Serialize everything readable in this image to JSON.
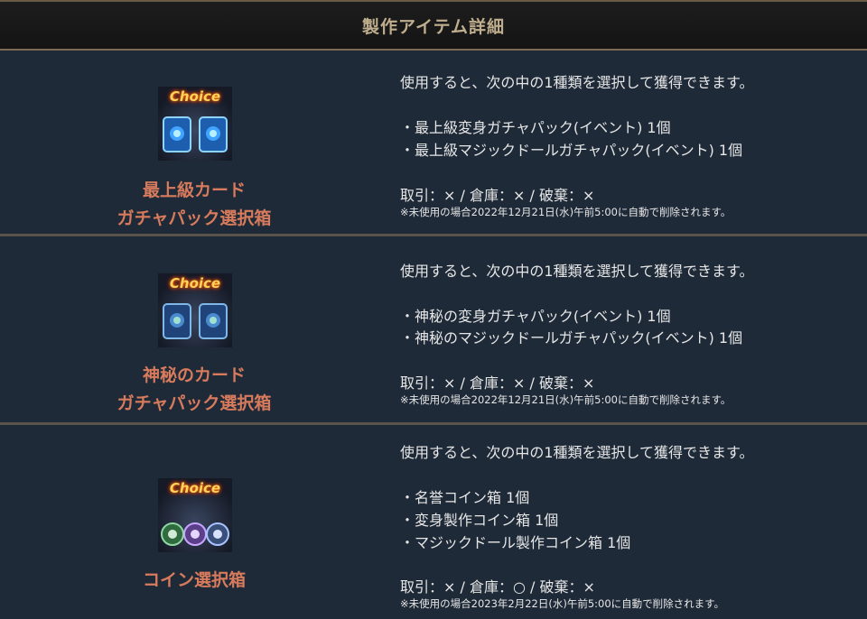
{
  "header": {
    "title": "製作アイテム詳細"
  },
  "items": [
    {
      "icon_badge": "Choice",
      "name_line1": "最上級カード",
      "name_line2": "ガチャパック選択箱",
      "description": "使用すると、次の中の1種類を選択して獲得できます。",
      "contents": [
        "・最上級変身ガチャパック(イベント) 1個",
        "・最上級マジックドールガチャパック(イベント) 1個"
      ],
      "trade": "取引：× / 倉庫：× / 破棄：×",
      "note": "※未使用の場合2022年12月21日(水)午前5:00に自動で削除されます。"
    },
    {
      "icon_badge": "Choice",
      "name_line1": "神秘のカード",
      "name_line2": "ガチャパック選択箱",
      "description": "使用すると、次の中の1種類を選択して獲得できます。",
      "contents": [
        "・神秘の変身ガチャパック(イベント) 1個",
        "・神秘のマジックドールガチャパック(イベント) 1個"
      ],
      "trade": "取引：× / 倉庫：× / 破棄：×",
      "note": "※未使用の場合2022年12月21日(水)午前5:00に自動で削除されます。"
    },
    {
      "icon_badge": "Choice",
      "name_line1": "コイン選択箱",
      "description": "使用すると、次の中の1種類を選択して獲得できます。",
      "contents": [
        "・名誉コイン箱 1個",
        "・変身製作コイン箱 1個",
        "・マジックドール製作コイン箱 1個"
      ],
      "trade": "取引：× / 倉庫：○ / 破棄：×",
      "note": "※未使用の場合2023年2月22日(水)午前5:00に自動で削除されます。"
    }
  ]
}
